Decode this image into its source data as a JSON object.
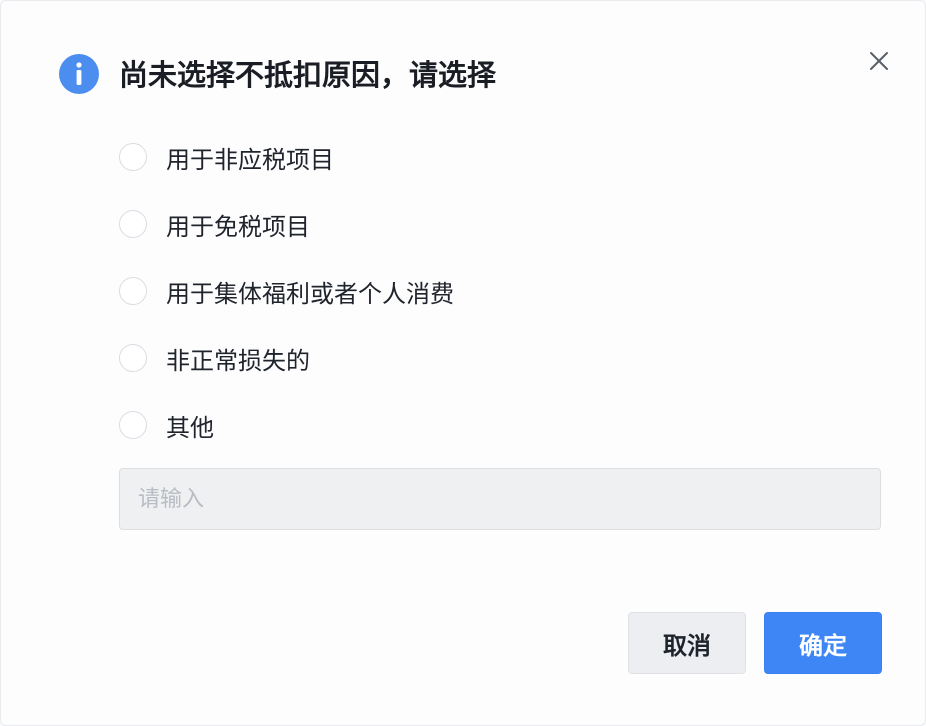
{
  "dialog": {
    "title": "尚未选择不抵扣原因，请选择",
    "icons": {
      "info": "info-icon",
      "close": "close-icon"
    },
    "accent_color": "#3e86f5",
    "options": [
      {
        "label": "用于非应税项目",
        "selected": false
      },
      {
        "label": "用于免税项目",
        "selected": false
      },
      {
        "label": "用于集体福利或者个人消费",
        "selected": false
      },
      {
        "label": "非正常损失的",
        "selected": false
      },
      {
        "label": "其他",
        "selected": false
      }
    ],
    "other_input": {
      "value": "",
      "placeholder": "请输入"
    },
    "buttons": {
      "cancel_label": "取消",
      "confirm_label": "确定"
    }
  }
}
